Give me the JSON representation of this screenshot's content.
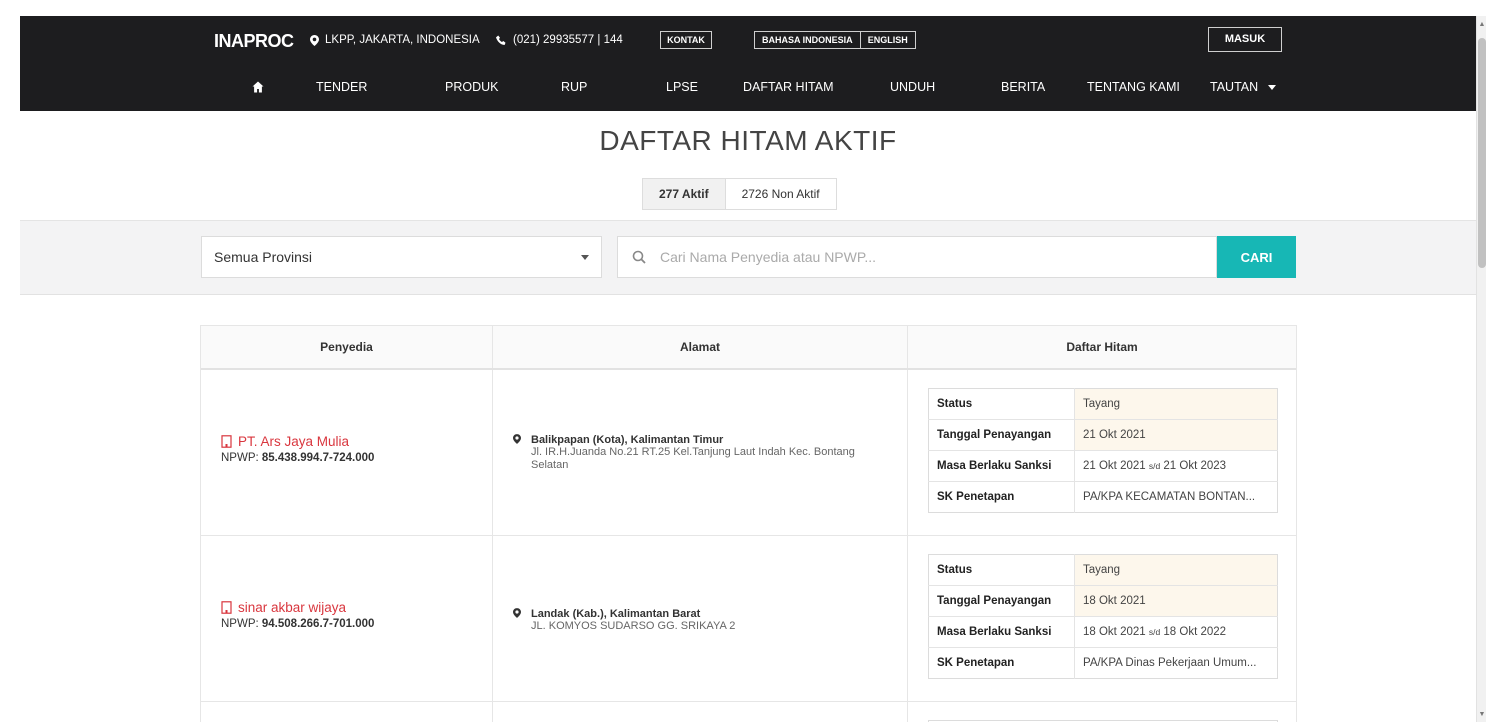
{
  "header": {
    "logo": "INAPROC",
    "location": "LKPP, JAKARTA, INDONESIA",
    "phone": "(021) 29935577 | 144",
    "contact_label": "KONTAK",
    "lang_id": "BAHASA INDONESIA",
    "lang_en": "ENGLISH",
    "login_label": "MASUK"
  },
  "nav": {
    "items": [
      "TENDER",
      "PRODUK",
      "RUP",
      "LPSE",
      "DAFTAR HITAM",
      "UNDUH",
      "BERITA",
      "TENTANG KAMI",
      "TAUTAN"
    ]
  },
  "page": {
    "title": "DAFTAR HITAM AKTIF",
    "tab_active": "277 Aktif",
    "tab_inactive": "2726 Non Aktif"
  },
  "filter": {
    "province_value": "Semua Provinsi",
    "search_placeholder": "Cari Nama Penyedia atau NPWP...",
    "search_button": "CARI"
  },
  "table": {
    "headers": [
      "Penyedia",
      "Alamat",
      "Daftar Hitam"
    ],
    "npwp_label": "NPWP: ",
    "info_labels": {
      "status": "Status",
      "date": "Tanggal Penayangan",
      "period": "Masa Berlaku Sanksi",
      "sk": "SK Penetapan"
    },
    "period_sep": "s/d",
    "rows": [
      {
        "name": "PT. Ars Jaya Mulia",
        "npwp": "85.438.994.7-724.000",
        "city": "Balikpapan (Kota), Kalimantan Timur",
        "street": "Jl. IR.H.Juanda No.21 RT.25 Kel.Tanjung Laut Indah Kec. Bontang Selatan",
        "status": "Tayang",
        "date": "21 Okt 2021",
        "period_start": "21 Okt 2021",
        "period_end": "21 Okt 2023",
        "sk": "PA/KPA KECAMATAN BONTAN..."
      },
      {
        "name": "sinar akbar wijaya",
        "npwp": "94.508.266.7-701.000",
        "city": "Landak (Kab.), Kalimantan Barat",
        "street": "JL. KOMYOS SUDARSO GG. SRIKAYA 2",
        "status": "Tayang",
        "date": "18 Okt 2021",
        "period_start": "18 Okt 2021",
        "period_end": "18 Okt 2022",
        "sk": "PA/KPA Dinas Pekerjaan Umum..."
      }
    ]
  }
}
